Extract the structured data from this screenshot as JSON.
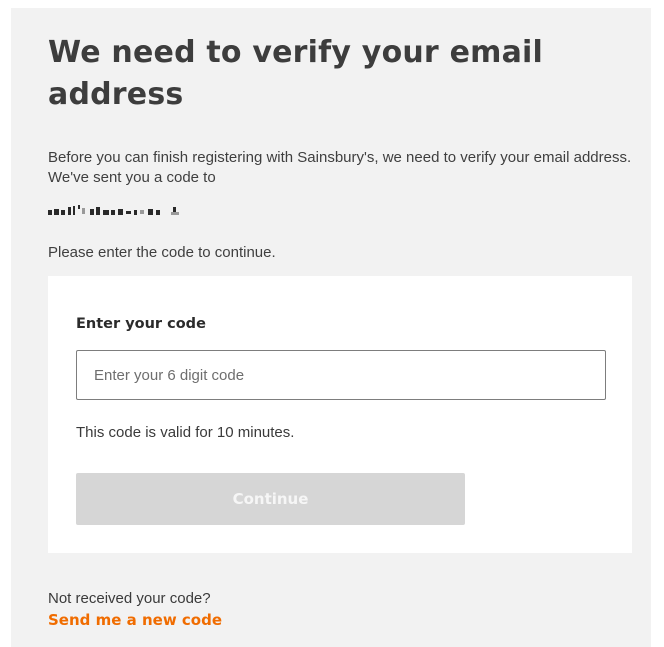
{
  "page": {
    "title": "We need to verify your email address",
    "intro": "Before you can finish registering with Sainsbury's, we need to verify your email address. We've sent you a code to",
    "instruction": "Please enter the code to continue."
  },
  "form": {
    "label": "Enter your code",
    "placeholder": "Enter your 6 digit code",
    "value": "",
    "validity": "This code is valid for 10 minutes.",
    "continue_label": "Continue"
  },
  "footer": {
    "prompt": "Not received your code?",
    "resend_label": "Send me a new code"
  },
  "colors": {
    "background": "#f2f2f2",
    "card": "#ffffff",
    "link": "#f06c00",
    "button_disabled": "#d6d6d6"
  }
}
